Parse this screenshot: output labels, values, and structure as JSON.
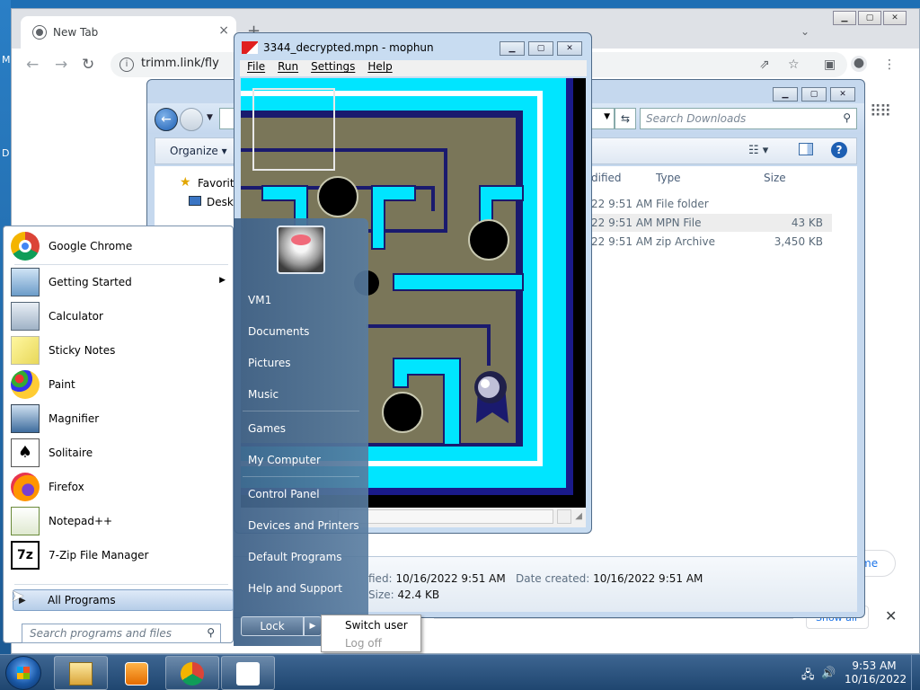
{
  "chrome": {
    "tab_title": "New Tab",
    "tab_close": "×",
    "new_tab": "+",
    "url": "trimm.link/fly",
    "bubble_text": "me",
    "show_all": "Show all",
    "close_bar": "✕"
  },
  "explorer": {
    "search_placeholder": "Search Downloads",
    "organize": "Organize ▾",
    "nav": {
      "favorites": "Favorites",
      "desktop": "Desktop"
    },
    "columns": [
      "dified",
      "Type",
      "Size"
    ],
    "rows": [
      {
        "modified": "22 9:51 AM",
        "type": "File folder",
        "size": ""
      },
      {
        "modified": "22 9:51 AM",
        "type": "MPN File",
        "size": "43 KB"
      },
      {
        "modified": "22 9:51 AM",
        "type": "zip Archive",
        "size": "3,450 KB"
      }
    ],
    "details": {
      "modified_label": "fied:",
      "modified_value": "10/16/2022 9:51 AM",
      "created_label": "Date created:",
      "created_value": "10/16/2022 9:51 AM",
      "size_label": "Size:",
      "size_value": "42.4 KB"
    }
  },
  "mophun": {
    "title": "3344_decrypted.mpn - mophun",
    "menu": [
      "File",
      "Run",
      "Settings",
      "Help"
    ]
  },
  "startmenu": {
    "programs": [
      {
        "label": "Google Chrome",
        "icon": "chrome-icon"
      },
      {
        "label": "Getting Started",
        "icon": "getting-started-icon",
        "submenu": true
      },
      {
        "label": "Calculator",
        "icon": "calculator-icon"
      },
      {
        "label": "Sticky Notes",
        "icon": "sticky-notes-icon"
      },
      {
        "label": "Paint",
        "icon": "paint-icon"
      },
      {
        "label": "Magnifier",
        "icon": "magnifier-icon"
      },
      {
        "label": "Solitaire",
        "icon": "solitaire-icon"
      },
      {
        "label": "Firefox",
        "icon": "firefox-icon"
      },
      {
        "label": "Notepad++",
        "icon": "notepadpp-icon"
      },
      {
        "label": "7-Zip File Manager",
        "icon": "7zip-icon"
      }
    ],
    "all_programs": "All Programs",
    "search_placeholder": "Search programs and files",
    "right": {
      "user": "VM1",
      "documents": "Documents",
      "pictures": "Pictures",
      "music": "Music",
      "games": "Games",
      "computer": "My Computer",
      "control_panel": "Control Panel",
      "devices": "Devices and Printers",
      "defaults": "Default Programs",
      "help": "Help and Support"
    },
    "lock": "Lock",
    "submenu": {
      "switch_user": "Switch user",
      "log_off": "Log off"
    }
  },
  "taskbar": {
    "time": "9:53 AM",
    "date": "10/16/2022",
    "pinned": [
      "explorer-icon",
      "media-player-icon",
      "chrome-icon",
      "mophun-icon"
    ]
  },
  "colors": {
    "maze_cyan": "#00e5ff",
    "maze_floor": "#7a7659",
    "maze_navy": "#1a1a6e"
  }
}
